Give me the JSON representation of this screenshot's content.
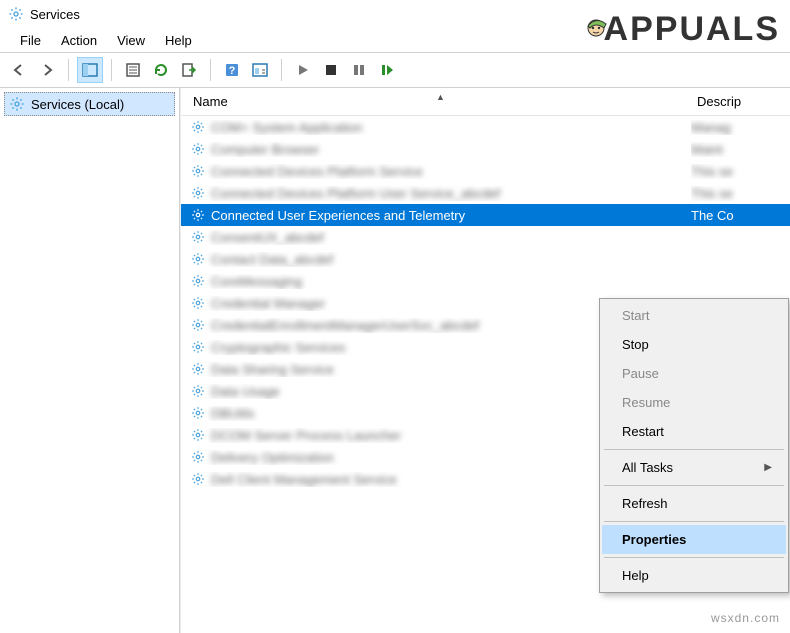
{
  "window": {
    "title": "Services"
  },
  "menubar": [
    "File",
    "Action",
    "View",
    "Help"
  ],
  "tree": {
    "root": "Services (Local)"
  },
  "columns": {
    "name": "Name",
    "description": "Descrip"
  },
  "selected_row": {
    "name": "Connected User Experiences and Telemetry",
    "description": "The Co"
  },
  "context_menu": {
    "start": "Start",
    "stop": "Stop",
    "pause": "Pause",
    "resume": "Resume",
    "restart": "Restart",
    "all_tasks": "All Tasks",
    "refresh": "Refresh",
    "properties": "Properties",
    "help": "Help"
  },
  "watermark": {
    "brand": "APPUALS",
    "site": "wsxdn.com"
  }
}
